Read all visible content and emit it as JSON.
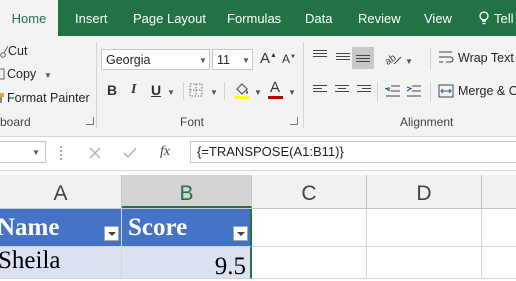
{
  "ribbon_tabs": [
    "Home",
    "Insert",
    "Page Layout",
    "Formulas",
    "Data",
    "Review",
    "View",
    "Tell"
  ],
  "clipboard": {
    "cut_label": "Cut",
    "copy_label": "Copy",
    "format_painter_label": "Format Painter",
    "group_label": "board"
  },
  "font": {
    "font_name": "Georgia",
    "font_size": "11",
    "group_label": "Font",
    "bold": "B",
    "italic": "I",
    "underline": "U"
  },
  "alignment": {
    "wrap_text_label": "Wrap Text",
    "merge_label": "Merge & C",
    "group_label": "Alignment"
  },
  "formula_bar": {
    "fx_label": "fx",
    "formula": "{=TRANSPOSE(A1:B11)}"
  },
  "columns": [
    "A",
    "B",
    "C",
    "D"
  ],
  "table": {
    "headers": [
      "Name",
      "Score"
    ],
    "rows": [
      [
        "Sheila",
        "9.5"
      ]
    ]
  },
  "colors": {
    "ribbon_green": "#217346",
    "table_header": "#4472c4",
    "table_row": "#d9e1f2",
    "font_color_bar": "#c00000",
    "fill_color_bar": "#ffff00"
  }
}
